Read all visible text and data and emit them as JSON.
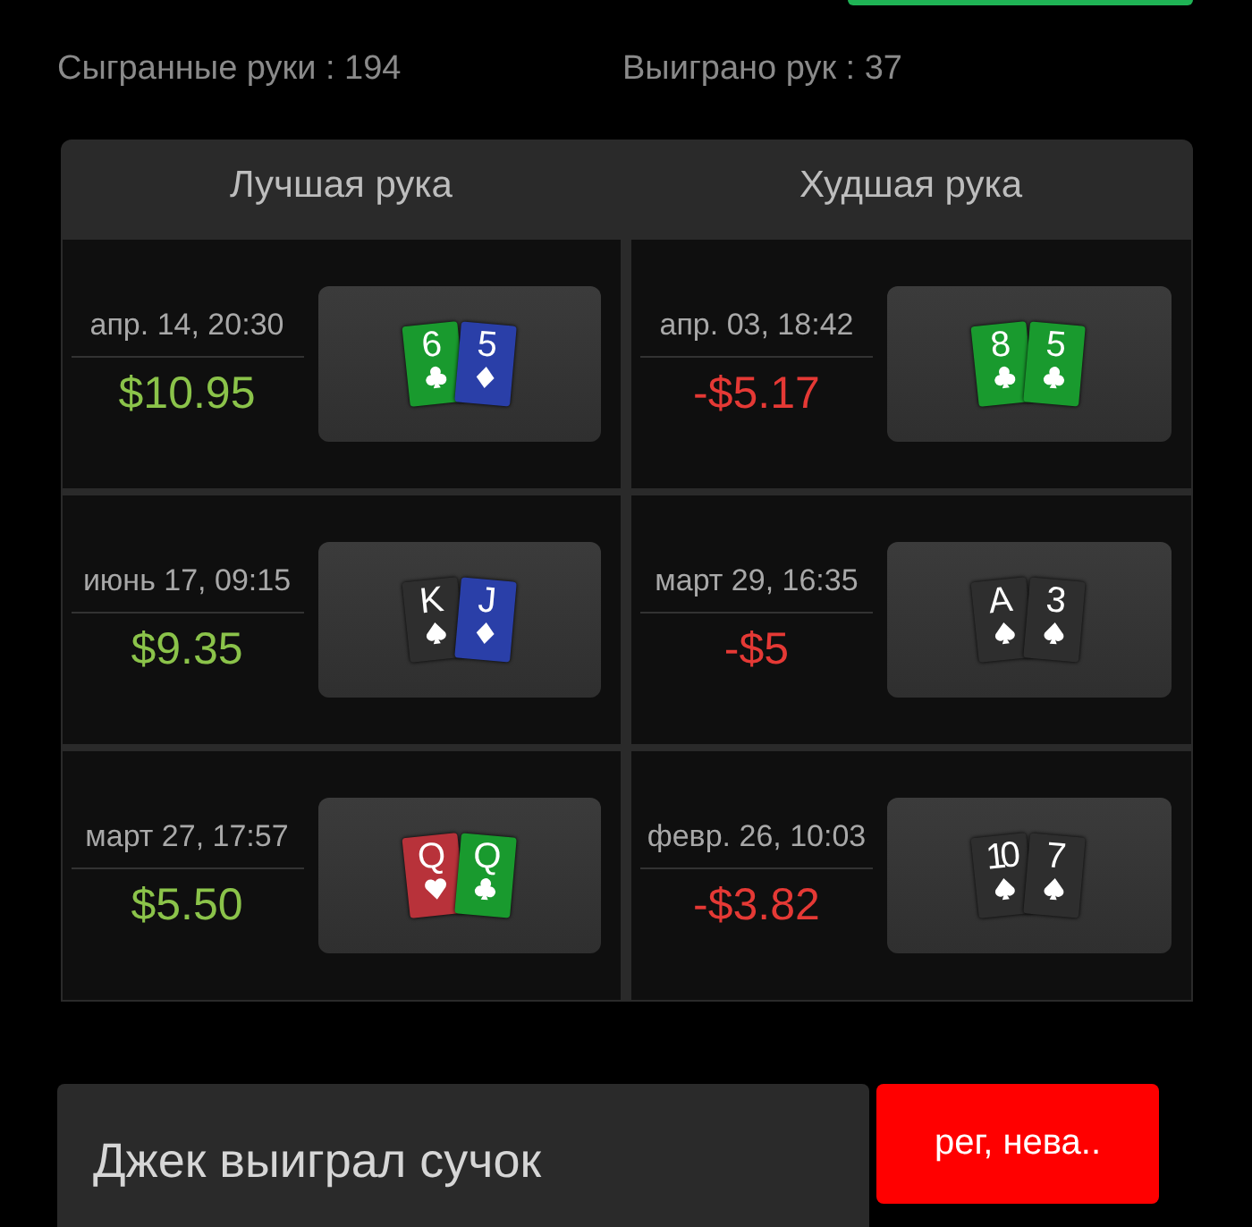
{
  "stats": [
    {
      "label": "Сыгранные руки : 194"
    },
    {
      "label": "Выиграно рук : 37"
    }
  ],
  "columns": [
    {
      "title": "Лучшая рука",
      "hands": [
        {
          "date": "апр. 14, 20:30",
          "amount": "$10.95",
          "won": true,
          "cards": [
            {
              "rank": "6",
              "kind": "clubs"
            },
            {
              "rank": "5",
              "kind": "diamonds"
            }
          ]
        },
        {
          "date": "июнь 17, 09:15",
          "amount": "$9.35",
          "won": true,
          "cards": [
            {
              "rank": "K",
              "kind": "spades"
            },
            {
              "rank": "J",
              "kind": "diamonds"
            }
          ]
        },
        {
          "date": "март 27, 17:57",
          "amount": "$5.50",
          "won": true,
          "cards": [
            {
              "rank": "Q",
              "kind": "hearts"
            },
            {
              "rank": "Q",
              "kind": "clubs"
            }
          ]
        }
      ]
    },
    {
      "title": "Худшая рука",
      "hands": [
        {
          "date": "апр. 03, 18:42",
          "amount": "-$5.17",
          "won": false,
          "cards": [
            {
              "rank": "8",
              "kind": "clubs"
            },
            {
              "rank": "5",
              "kind": "clubs"
            }
          ]
        },
        {
          "date": "март 29, 16:35",
          "amount": "-$5",
          "won": false,
          "cards": [
            {
              "rank": "A",
              "kind": "spades"
            },
            {
              "rank": "3",
              "kind": "spades"
            }
          ]
        },
        {
          "date": "февр. 26, 10:03",
          "amount": "-$3.82",
          "won": false,
          "cards": [
            {
              "rank": "10",
              "kind": "spades"
            },
            {
              "rank": "7",
              "kind": "spades"
            }
          ]
        }
      ]
    }
  ],
  "message": {
    "text": "Джек выиграл сучок",
    "tag": "рег, нева.."
  }
}
